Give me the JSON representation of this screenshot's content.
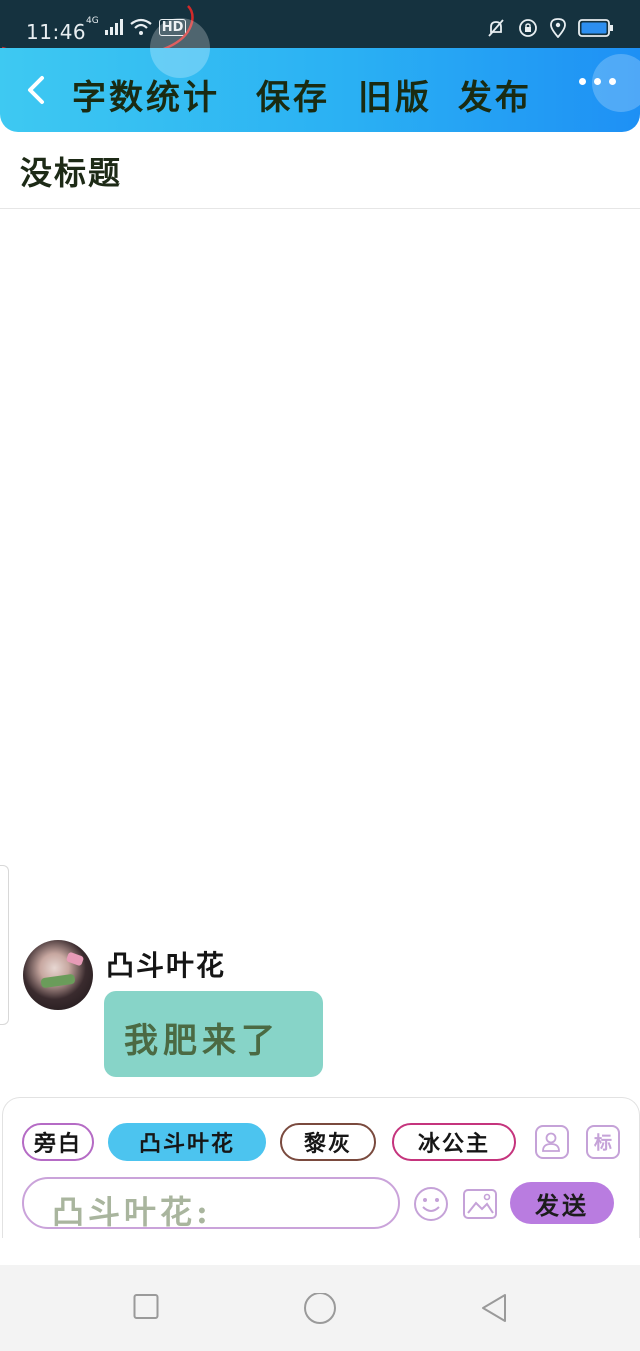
{
  "status_bar": {
    "time": "11:46",
    "network": "4G",
    "hd": "HD"
  },
  "toolbar": {
    "word_count": "字数统计",
    "save": "保存",
    "old_version": "旧版",
    "publish": "发布"
  },
  "document": {
    "title": "没标题"
  },
  "message": {
    "sender": "凸斗叶花",
    "text": "我肥来了"
  },
  "composer": {
    "roles": [
      "旁白",
      "凸斗叶花",
      "黎灰",
      "冰公主"
    ],
    "mark_label": "标",
    "input_value": "凸斗叶花:",
    "send_label": "发送"
  },
  "colors": {
    "appbar_start": "#3ec9f2",
    "appbar_end": "#1e90f5",
    "bubble": "#87d4c8",
    "active_chip": "#4cc4ef",
    "send_button": "#b97ce0"
  }
}
